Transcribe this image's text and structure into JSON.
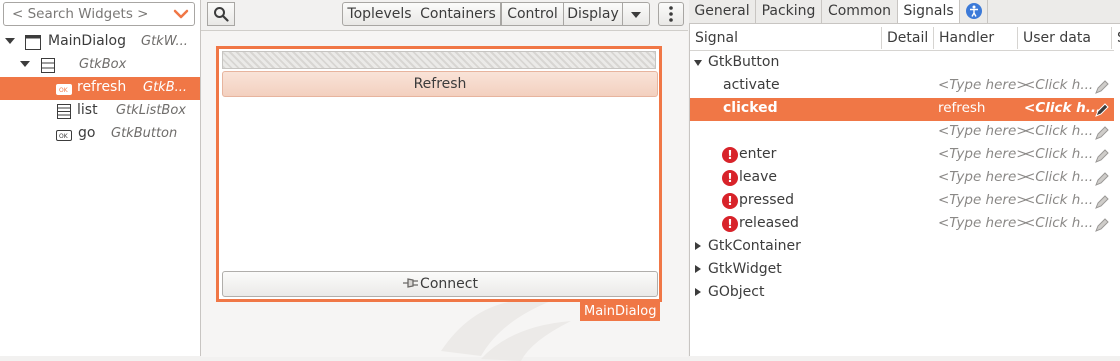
{
  "left_pane": {
    "search_placeholder": "< Search Widgets >",
    "tree": [
      {
        "name": "MainDialog",
        "cls": "GtkW...",
        "icon": "window-icon"
      },
      {
        "name": "",
        "cls": "GtkBox",
        "icon": "box-icon"
      },
      {
        "name": "refresh",
        "cls": "GtkB...",
        "icon": "button-icon",
        "selected": true
      },
      {
        "name": "list",
        "cls": "GtkListBox",
        "icon": "listbox-icon"
      },
      {
        "name": "go",
        "cls": "GtkButton",
        "icon": "button-icon"
      }
    ]
  },
  "toolbar": {
    "toplevels": "Toplevels",
    "containers": "Containers",
    "control": "Control",
    "display": "Display"
  },
  "canvas": {
    "refresh_button": "Refresh",
    "connect_button": "Connect",
    "dialog_label": "MainDialog"
  },
  "right_pane": {
    "tabs": [
      "General",
      "Packing",
      "Common",
      "Signals"
    ],
    "active_tab": "Signals",
    "columns": [
      "Signal",
      "Detail",
      "Handler",
      "User data",
      "S"
    ],
    "rows": [
      {
        "type": "group",
        "label": "GtkButton",
        "expanded": true
      },
      {
        "type": "signal",
        "label": "activate",
        "handler": "<Type here>",
        "user_data": "<Click h..."
      },
      {
        "type": "signal",
        "label": "clicked",
        "handler": "refresh",
        "user_data": "<Click h...",
        "selected": true
      },
      {
        "type": "signal",
        "label": "",
        "handler": "<Type here>",
        "user_data": "<Click h..."
      },
      {
        "type": "signal",
        "label": "enter",
        "handler": "<Type here>",
        "user_data": "<Click h...",
        "error": true
      },
      {
        "type": "signal",
        "label": "leave",
        "handler": "<Type here>",
        "user_data": "<Click h...",
        "error": true
      },
      {
        "type": "signal",
        "label": "pressed",
        "handler": "<Type here>",
        "user_data": "<Click h...",
        "error": true
      },
      {
        "type": "signal",
        "label": "released",
        "handler": "<Type here>",
        "user_data": "<Click h...",
        "error": true
      },
      {
        "type": "group",
        "label": "GtkContainer",
        "expanded": false
      },
      {
        "type": "group",
        "label": "GtkWidget",
        "expanded": false
      },
      {
        "type": "group",
        "label": "GObject",
        "expanded": false
      }
    ]
  },
  "colors": {
    "accent": "#f07746",
    "error": "#d8232a"
  }
}
